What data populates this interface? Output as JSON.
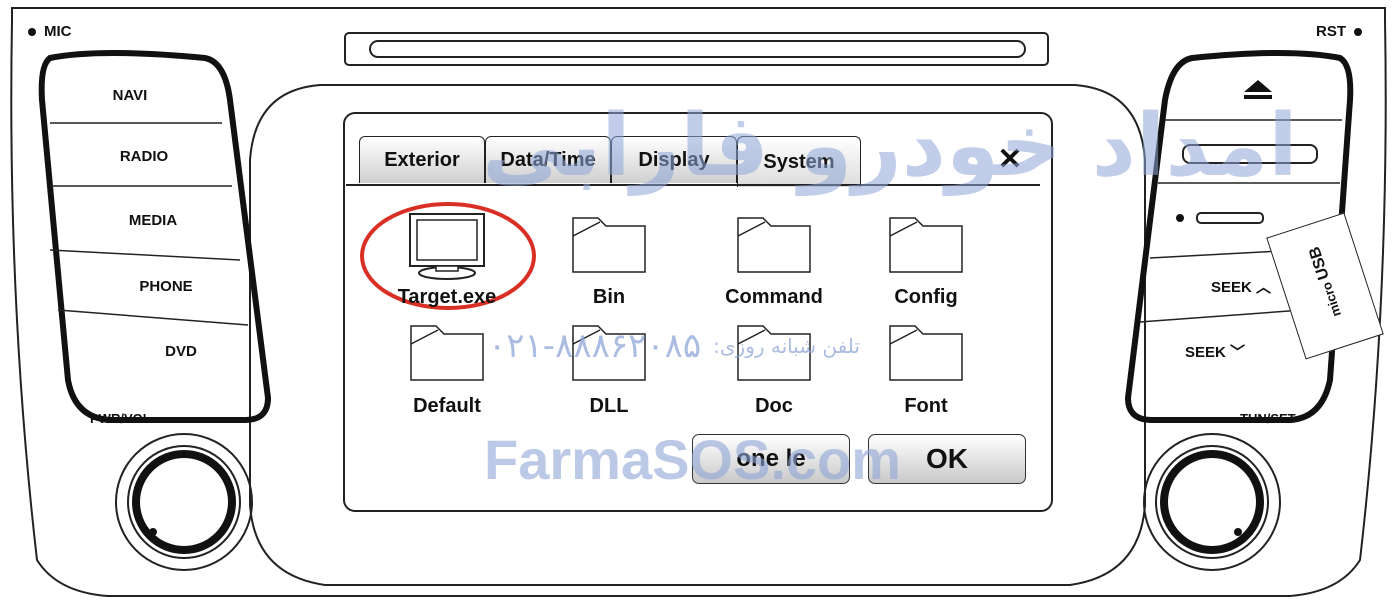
{
  "panel": {
    "mic_label": "MIC",
    "rst_label": "RST",
    "pwr_vol_label": "PWR/VOL",
    "tun_set_label": "TUN/SET",
    "left_buttons": [
      "NAVI",
      "RADIO",
      "MEDIA",
      "PHONE",
      "DVD"
    ],
    "right_buttons": {
      "seek_up": "SEEK ︿",
      "seek_down": "SEEK ﹀"
    },
    "usb_card": {
      "line1": "micro",
      "line2": "USB"
    }
  },
  "dialog": {
    "tabs": [
      "Exterior",
      "Data/Time",
      "Display",
      "System"
    ],
    "active_tab": "System",
    "close_glyph": "✕",
    "items": [
      {
        "label": "Target.exe",
        "icon": "monitor-icon"
      },
      {
        "label": "Bin",
        "icon": "folder-icon"
      },
      {
        "label": "Command",
        "icon": "folder-icon"
      },
      {
        "label": "Config",
        "icon": "folder-icon"
      },
      {
        "label": "Default",
        "icon": "folder-icon"
      },
      {
        "label": "DLL",
        "icon": "folder-icon"
      },
      {
        "label": "Doc",
        "icon": "folder-icon"
      },
      {
        "label": "Font",
        "icon": "folder-icon"
      }
    ],
    "buttons": {
      "secondary": "one le",
      "ok": "OK"
    }
  },
  "watermark": {
    "persian_name": "امداد خودرو فارابی",
    "phone_label": "تلفن شبانه روزی:",
    "phone_number": "۰۲۱-۸۸۸۶۲۰۸۵",
    "site": "FarmaSOS.com"
  },
  "colors": {
    "highlight_circle": "#d93025",
    "watermark": "#8fa6d8"
  }
}
